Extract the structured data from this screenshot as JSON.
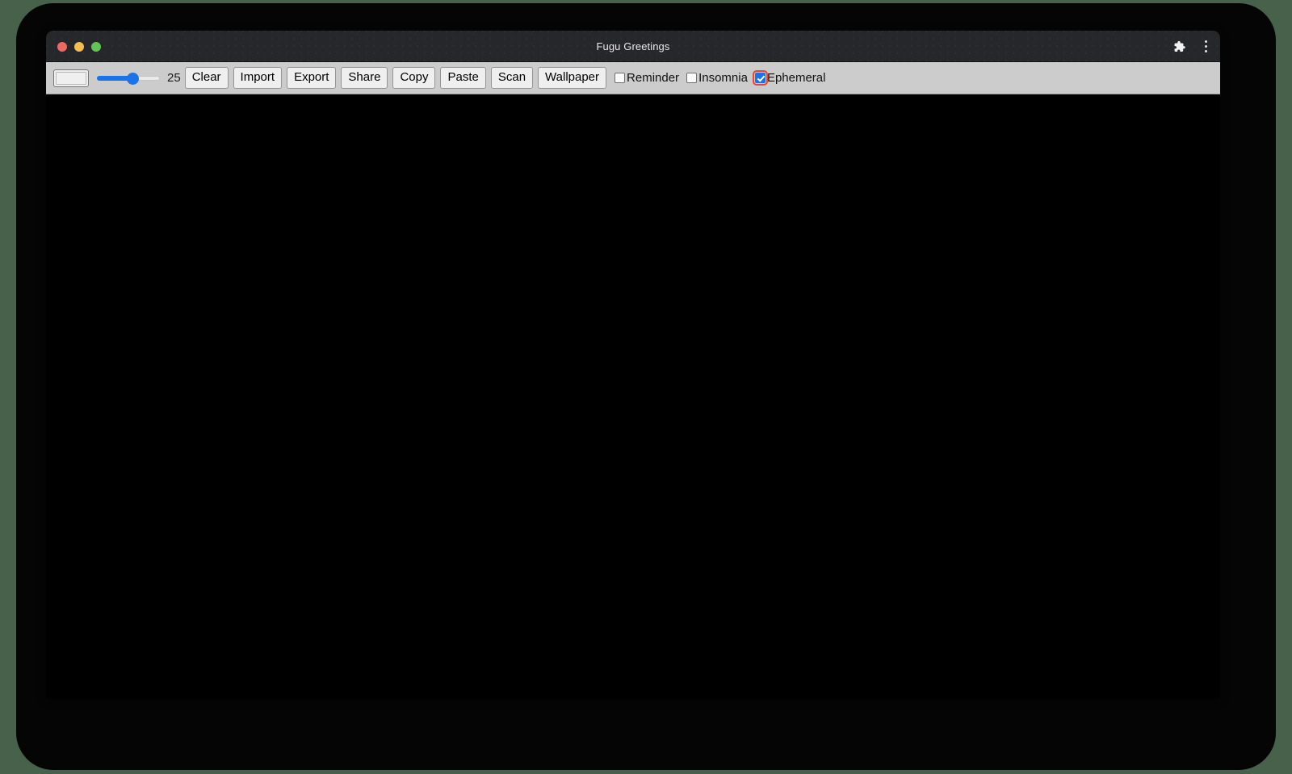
{
  "window": {
    "title": "Fugu Greetings",
    "traffic_lights": [
      {
        "name": "close",
        "color": "#ed6a5f"
      },
      {
        "name": "minimize",
        "color": "#f4bd4f"
      },
      {
        "name": "zoom",
        "color": "#61c554"
      }
    ],
    "actions": [
      {
        "icon": "extensions-puzzle-icon"
      },
      {
        "icon": "overflow-menu-icon"
      }
    ]
  },
  "toolbar": {
    "color_picker": {
      "value": "#efefef"
    },
    "slider": {
      "value": "25",
      "min": "0",
      "max": "50",
      "percent": 55,
      "accent": "#1a73e8"
    },
    "size_value_label": "25",
    "buttons": [
      {
        "label": "Clear"
      },
      {
        "label": "Import"
      },
      {
        "label": "Export"
      },
      {
        "label": "Share"
      },
      {
        "label": "Copy"
      },
      {
        "label": "Paste"
      },
      {
        "label": "Scan"
      },
      {
        "label": "Wallpaper"
      }
    ],
    "checkboxes": [
      {
        "label": "Reminder",
        "checked": false,
        "focused": false
      },
      {
        "label": "Insomnia",
        "checked": false,
        "focused": false
      },
      {
        "label": "Ephemeral",
        "checked": true,
        "focused": true
      }
    ]
  },
  "canvas": {
    "background": "#000000",
    "content": ""
  },
  "colors": {
    "desktop_background": "#47614b",
    "backdrop": "#050505",
    "titlebar": "#26272b",
    "toolbar": "#cccccc",
    "accent": "#1a73e8",
    "focus_ring": "#e8462f"
  }
}
